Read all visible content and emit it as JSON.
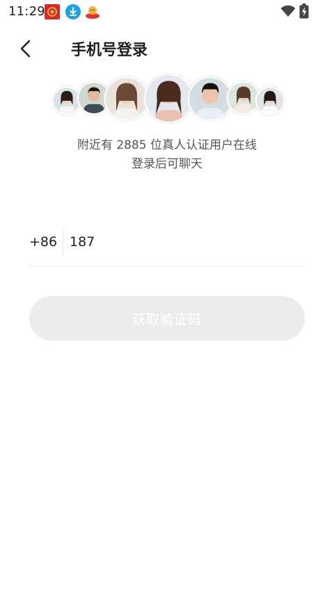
{
  "status_bar": {
    "time": "11:29",
    "notification_icons": [
      "app-icon-red",
      "download-icon",
      "app-icon-mascot"
    ],
    "wifi_icon": "wifi-icon",
    "battery_icon": "battery-charging-icon"
  },
  "header": {
    "back_icon": "chevron-left-icon",
    "title": "手机号登录"
  },
  "avatars": [
    "avatar-1",
    "avatar-2",
    "avatar-3",
    "avatar-4",
    "avatar-5",
    "avatar-6",
    "avatar-7"
  ],
  "info": {
    "line1": "附近有 2885 位真人认证用户在线",
    "line2": "登录后可聊天"
  },
  "phone": {
    "country_code": "+86",
    "value": "187"
  },
  "get_code_button": {
    "label": "获取验证码",
    "enabled": false
  },
  "colors": {
    "button_bg_disabled": "#ececec",
    "button_text_disabled": "#ffffff",
    "title_text": "#1e1e1e",
    "info_text": "#555555"
  }
}
